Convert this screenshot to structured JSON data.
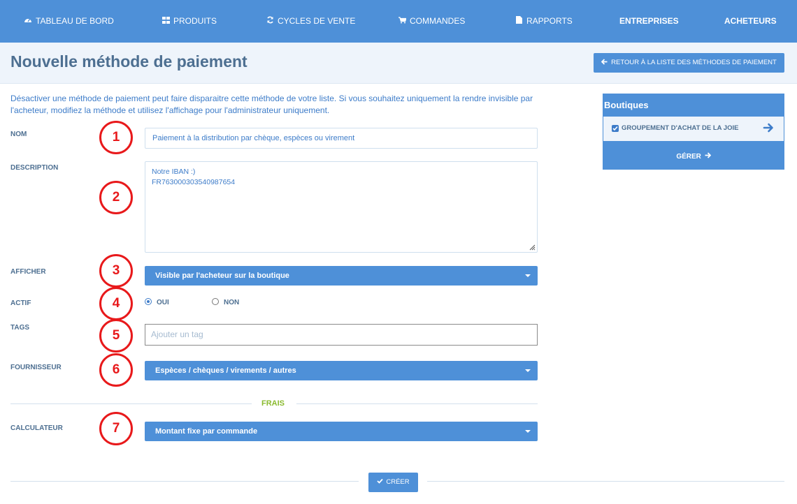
{
  "nav": {
    "items": [
      {
        "label": "Tableau de bord",
        "icon": "dashboard-icon",
        "glyph": "⚙"
      },
      {
        "label": "Produits",
        "icon": "grid-icon",
        "glyph": "▦"
      },
      {
        "label": "Cycles de vente",
        "icon": "refresh-icon",
        "glyph": "⟳"
      },
      {
        "label": "Commandes",
        "icon": "cart-icon",
        "glyph": "🛒"
      },
      {
        "label": "Rapports",
        "icon": "file-icon",
        "glyph": "▆"
      },
      {
        "label": "Entreprises"
      },
      {
        "label": "Acheteurs"
      }
    ]
  },
  "page": {
    "title": "Nouvelle méthode de paiement",
    "back_button": "Retour à la liste des méthodes de paiement",
    "info": "Désactiver une méthode de paiement peut faire disparaitre cette méthode de votre liste. Si vous souhaitez uniquement la rendre invisible par l'acheteur, modifiez la méthode et utilisez l'affichage pour l'administrateur uniquement."
  },
  "form": {
    "nom": {
      "label": "Nom",
      "value": "Paiement à la distribution par chèque, espèces ou virement"
    },
    "description": {
      "label": "Description",
      "line1": "Notre IBAN :)",
      "line2": "FR763000303540987654"
    },
    "afficher": {
      "label": "Afficher",
      "value": "Visible par l'acheteur sur la boutique"
    },
    "actif": {
      "label": "Actif",
      "oui": "Oui",
      "non": "Non",
      "selected": "oui"
    },
    "tags": {
      "label": "Tags",
      "placeholder": "Ajouter un tag"
    },
    "fournisseur": {
      "label": "Fournisseur",
      "value": "Espèces / chèques / virements / autres"
    },
    "section_frais": "Frais",
    "calculateur": {
      "label": "Calculateur",
      "value": "Montant fixe par commande"
    },
    "create_button": "Créer"
  },
  "annotations": [
    "1",
    "2",
    "3",
    "4",
    "5",
    "6",
    "7"
  ],
  "sidebar": {
    "title": "Boutiques",
    "shop_name": "Groupement d'achat de la joie",
    "manage": "Gérer"
  },
  "colors": {
    "primary": "#4e90d8",
    "header_bg": "#eef4fb",
    "text": "#4d6f91",
    "link_text": "#3d7cc9",
    "accent_green": "#8aba2f",
    "annotation_red": "#e8191b"
  }
}
